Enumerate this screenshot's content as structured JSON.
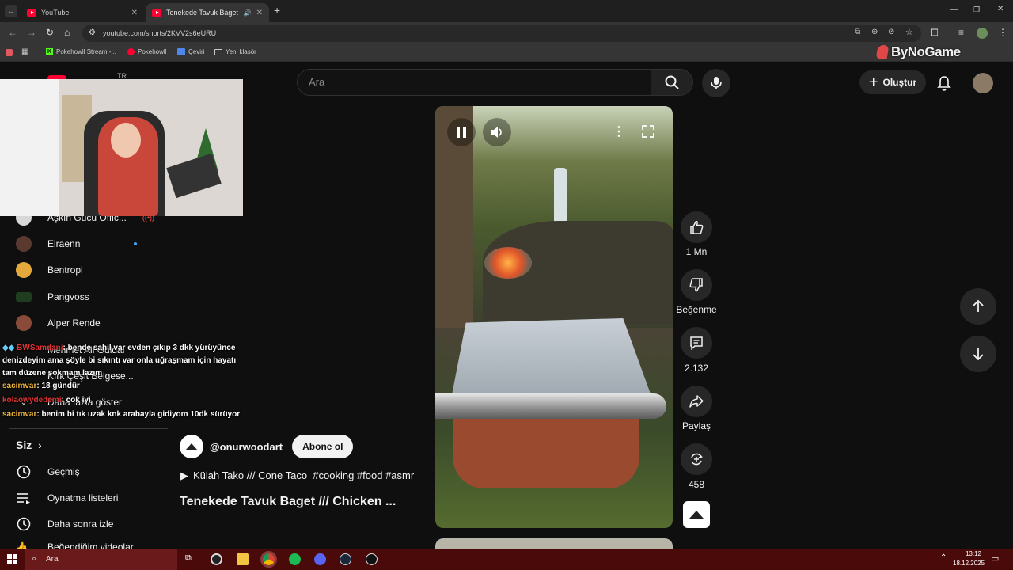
{
  "browser": {
    "tabs": [
      {
        "title": "YouTube"
      },
      {
        "title": "Tenekede Tavuk Baget /// C"
      }
    ],
    "url": "youtube.com/shorts/2KVV2s6eURU",
    "bookmarks": [
      "Pokehowll Stream -...",
      "Pokehowll",
      "Çeviri",
      "Yeni klasör"
    ]
  },
  "overlay": {
    "watermark": "ByNoGame"
  },
  "header": {
    "country": "TR",
    "search_placeholder": "Ara",
    "create_label": "Oluştur"
  },
  "sidebar": {
    "channels": [
      {
        "name": "Aşkın Gücü Offic..."
      },
      {
        "name": "Elraenn"
      },
      {
        "name": "Bentropi"
      },
      {
        "name": "Pangvoss"
      },
      {
        "name": "Alper Rende"
      },
      {
        "name": "Mehmet Ali Güldal"
      },
      {
        "name": "Kırk Çeşit Belgese..."
      },
      {
        "name": "Daha fazla göster"
      }
    ],
    "you_label": "Siz",
    "items": [
      {
        "label": "Geçmiş"
      },
      {
        "label": "Oynatma listeleri"
      },
      {
        "label": "Daha sonra izle"
      },
      {
        "label": "Beğendiğim videolar"
      }
    ]
  },
  "chat": [
    {
      "user": "BWSamdani",
      "text": ": bende sahil var evden çıkıp 3 dkk yürüyünce denizdeyim ama şöyle bi sıkıntı var onla uğraşmam için hayatı tam düzene sokmam lazım"
    },
    {
      "user": "sacimvar",
      "text": ": 18 gündür"
    },
    {
      "user": "kolaowydedemi",
      "text": ": cok iyi"
    },
    {
      "user": "sacimvar",
      "text": ": benim bi tık uzak knk arabayla gidiyom 10dk sürüyor"
    }
  ],
  "short": {
    "channel": "@onurwoodart",
    "subscribe_label": "Abone ol",
    "music": "Külah Tako /// Cone Taco  #cooking #food #asmr",
    "title": "Tenekede Tavuk Baget /// Chicken ...",
    "likes": "1 Mn",
    "dislike_label": "Beğenme",
    "comments": "2.132",
    "share_label": "Paylaş",
    "remix": "458"
  },
  "taskbar": {
    "search_placeholder": "Ara",
    "time": "13:12",
    "date": "18.12.2025"
  }
}
